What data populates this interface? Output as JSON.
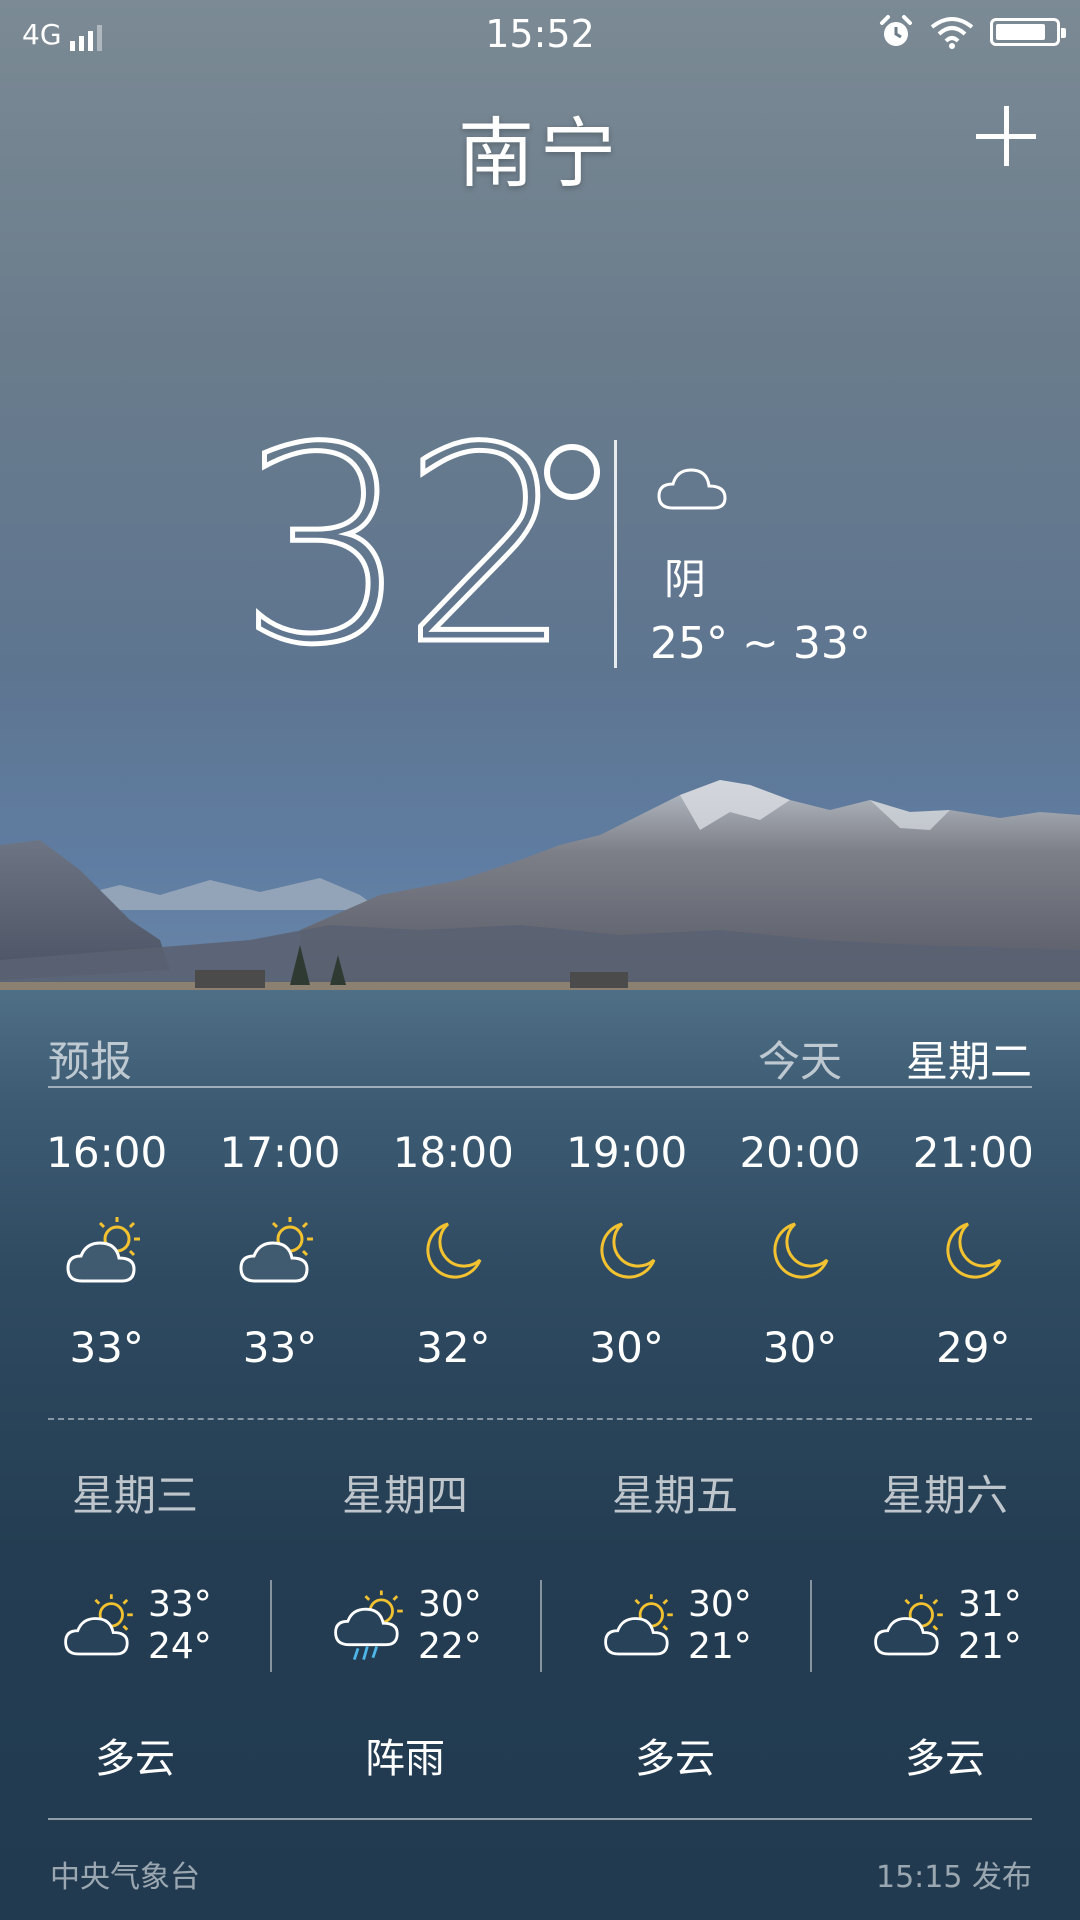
{
  "status_bar": {
    "network": "4G",
    "time": "15:52",
    "battery_level": 0.85,
    "icons": [
      "signal-icon",
      "alarm-icon",
      "wifi-icon",
      "battery-icon"
    ]
  },
  "header": {
    "city": "南宁",
    "add_icon": "plus-icon"
  },
  "current": {
    "temp": "32",
    "condition": "阴",
    "range": "25° ~ 33°",
    "icon": "cloud-icon"
  },
  "forecast": {
    "title": "预报",
    "today_label": "今天",
    "selected_day": "星期二",
    "hourly": [
      {
        "time": "16:00",
        "icon": "partly-cloudy-icon",
        "temp": "33°"
      },
      {
        "time": "17:00",
        "icon": "partly-cloudy-icon",
        "temp": "33°"
      },
      {
        "time": "18:00",
        "icon": "moon-icon",
        "temp": "32°"
      },
      {
        "time": "19:00",
        "icon": "moon-icon",
        "temp": "30°"
      },
      {
        "time": "20:00",
        "icon": "moon-icon",
        "temp": "30°"
      },
      {
        "time": "21:00",
        "icon": "moon-icon",
        "temp": "29°"
      }
    ],
    "daily": [
      {
        "day": "星期三",
        "icon": "partly-cloudy-icon",
        "high": "33°",
        "low": "24°",
        "desc": "多云"
      },
      {
        "day": "星期四",
        "icon": "shower-icon",
        "high": "30°",
        "low": "22°",
        "desc": "阵雨"
      },
      {
        "day": "星期五",
        "icon": "partly-cloudy-icon",
        "high": "30°",
        "low": "21°",
        "desc": "多云"
      },
      {
        "day": "星期六",
        "icon": "partly-cloudy-icon",
        "high": "31°",
        "low": "21°",
        "desc": "多云"
      }
    ]
  },
  "footer": {
    "source": "中央气象台",
    "published": "15:15 发布"
  },
  "colors": {
    "sun": "#f2c230",
    "rain": "#4fb6e8",
    "text": "#ffffff"
  }
}
